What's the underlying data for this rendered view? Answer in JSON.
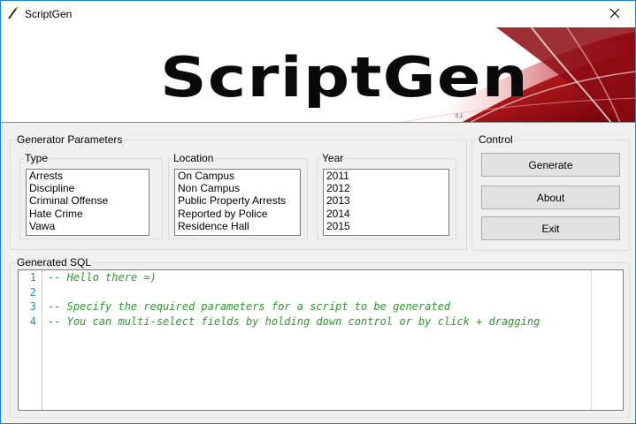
{
  "window": {
    "title": "ScriptGen",
    "icon": "wand-icon"
  },
  "banner": {
    "logo_text": "ScriptGen",
    "version": "0.1",
    "accent_color": "#c8102e"
  },
  "generator_parameters": {
    "title": "Generator Parameters",
    "type": {
      "title": "Type",
      "items": [
        "Arrests",
        "Discipline",
        "Criminal Offense",
        "Hate Crime",
        "Vawa"
      ]
    },
    "location": {
      "title": "Location",
      "items": [
        "On Campus",
        "Non Campus",
        "Public Property Arrests",
        "Reported by Police",
        "Residence Hall"
      ]
    },
    "year": {
      "title": "Year",
      "items": [
        "2011",
        "2012",
        "2013",
        "2014",
        "2015"
      ]
    }
  },
  "control": {
    "title": "Control",
    "generate_label": "Generate",
    "about_label": "About",
    "exit_label": "Exit"
  },
  "generated_sql": {
    "title": "Generated SQL",
    "line_numbers": [
      "1",
      "2",
      "3",
      "4"
    ],
    "lines": [
      "-- Hello there =)",
      "",
      "-- Specify the required parameters for a script to be generated",
      "-- You can multi-select fields by holding down control or by click + dragging"
    ]
  }
}
